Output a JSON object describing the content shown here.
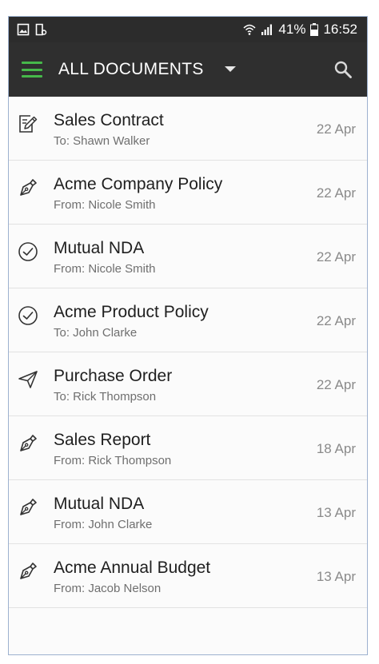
{
  "status_bar": {
    "battery": "41%",
    "time": "16:52",
    "icons": [
      "image-icon",
      "clipboard-icon",
      "wifi-icon",
      "signal-icon",
      "battery-icon"
    ]
  },
  "app_bar": {
    "title": "ALL DOCUMENTS",
    "accent_color": "#46b84a",
    "icons": [
      "menu-icon",
      "dropdown-arrow-icon",
      "search-icon"
    ]
  },
  "documents": [
    {
      "icon": "edit-document-icon",
      "title": "Sales Contract",
      "subtitle": "To: Shawn Walker",
      "date": "22 Apr"
    },
    {
      "icon": "pen-nib-icon",
      "title": "Acme Company Policy",
      "subtitle": "From: Nicole Smith",
      "date": "22 Apr"
    },
    {
      "icon": "check-circle-icon",
      "title": "Mutual NDA",
      "subtitle": "From: Nicole Smith",
      "date": "22 Apr"
    },
    {
      "icon": "check-circle-icon",
      "title": "Acme Product Policy",
      "subtitle": "To: John Clarke",
      "date": "22 Apr"
    },
    {
      "icon": "send-icon",
      "title": "Purchase Order",
      "subtitle": "To: Rick Thompson",
      "date": "22 Apr"
    },
    {
      "icon": "pen-nib-icon",
      "title": "Sales Report",
      "subtitle": "From: Rick Thompson",
      "date": "18 Apr"
    },
    {
      "icon": "pen-nib-icon",
      "title": "Mutual NDA",
      "subtitle": "From: John Clarke",
      "date": "13 Apr"
    },
    {
      "icon": "pen-nib-icon",
      "title": "Acme Annual Budget",
      "subtitle": "From: Jacob Nelson",
      "date": "13 Apr"
    }
  ]
}
